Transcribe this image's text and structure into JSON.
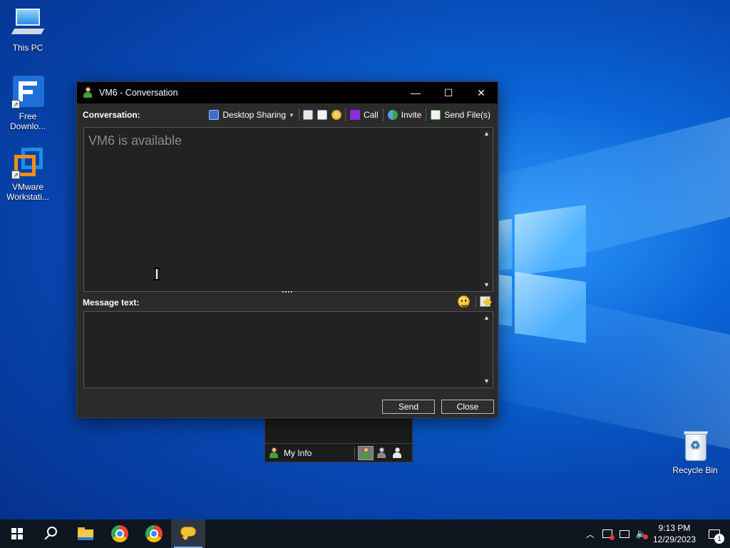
{
  "desktop": {
    "icons": [
      {
        "label": "This PC",
        "icon": "this-pc-icon"
      },
      {
        "label": "Free Downlo...",
        "icon": "free-download-manager-icon"
      },
      {
        "label": "VMware Workstati...",
        "icon": "vmware-workstation-icon"
      },
      {
        "label": "Recycle Bin",
        "icon": "recycle-bin-icon"
      }
    ]
  },
  "window": {
    "title": "VM6 - Conversation",
    "controls": {
      "minimize": "—",
      "maximize": "☐",
      "close": "✕"
    },
    "toolbar": {
      "label": "Conversation:",
      "desktop_sharing": "Desktop Sharing",
      "call": "Call",
      "invite": "Invite",
      "send_files": "Send File(s)"
    },
    "conversation_status": "VM6 is available",
    "message_label": "Message text:",
    "message_value": "",
    "send_button": "Send",
    "close_button": "Close"
  },
  "contact_window": {
    "my_info": "My Info"
  },
  "taskbar": {
    "time": "9:13 PM",
    "date": "12/29/2023",
    "notification_count": "1"
  }
}
